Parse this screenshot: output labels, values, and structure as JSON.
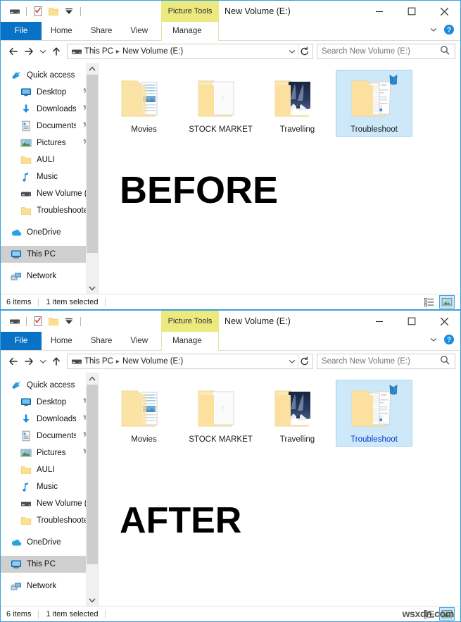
{
  "windows": [
    {
      "key": "before",
      "annotation": "BEFORE",
      "titlebar": {
        "context_tab": "Picture Tools",
        "title": "New Volume (E:)",
        "quick_access": [
          {
            "name": "drive-icon",
            "label": "Drive"
          },
          {
            "name": "properties-icon",
            "label": "Properties"
          },
          {
            "name": "new-folder-icon",
            "label": "New folder"
          },
          {
            "name": "customize-quick-access-icon",
            "label": "Customize Quick Access Toolbar"
          }
        ],
        "minimize_label": "Minimize",
        "maximize_label": "Maximize",
        "close_label": "Close"
      },
      "ribbon": {
        "tabs": [
          "File",
          "Home",
          "Share",
          "View",
          "Manage"
        ],
        "collapse_label": "Minimize the Ribbon",
        "help_label": "Help"
      },
      "address": {
        "back_label": "Back",
        "forward_label": "Forward",
        "recent_label": "Recent locations",
        "up_label": "Up",
        "crumbs": [
          "This PC",
          "New Volume (E:)"
        ],
        "dropdown_label": "Previous locations",
        "refresh_label": "Refresh",
        "search_placeholder": "Search New Volume (E:)"
      },
      "sidebar": {
        "items": [
          {
            "label": "Quick access",
            "icon": "star-icon",
            "indent": 0,
            "pinned": false,
            "selected": false
          },
          {
            "label": "Desktop",
            "icon": "desktop-icon",
            "indent": 1,
            "pinned": true,
            "selected": false
          },
          {
            "label": "Downloads",
            "icon": "download-icon",
            "indent": 1,
            "pinned": true,
            "selected": false
          },
          {
            "label": "Documents",
            "icon": "document-icon",
            "indent": 1,
            "pinned": true,
            "selected": false
          },
          {
            "label": "Pictures",
            "icon": "picture-icon",
            "indent": 1,
            "pinned": true,
            "selected": false
          },
          {
            "label": "AULI",
            "icon": "folder-icon",
            "indent": 1,
            "pinned": false,
            "selected": false
          },
          {
            "label": "Music",
            "icon": "music-icon",
            "indent": 1,
            "pinned": false,
            "selected": false
          },
          {
            "label": "New Volume (E:)",
            "icon": "drive-icon",
            "indent": 1,
            "pinned": false,
            "selected": false
          },
          {
            "label": "Troubleshooter W",
            "icon": "folder-icon",
            "indent": 1,
            "pinned": false,
            "selected": false
          },
          {
            "label": "OneDrive",
            "icon": "onedrive-icon",
            "indent": 0,
            "pinned": false,
            "selected": false,
            "gap_before": true
          },
          {
            "label": "This PC",
            "icon": "thispc-icon",
            "indent": 0,
            "pinned": false,
            "selected": true,
            "gap_before": true
          },
          {
            "label": "Network",
            "icon": "network-icon",
            "indent": 0,
            "pinned": false,
            "selected": false,
            "gap_before": true
          }
        ]
      },
      "files": [
        {
          "name": "Movies",
          "thumb": "movies-folder-icon",
          "selected": false
        },
        {
          "name": "STOCK MARKET",
          "thumb": "document-folder-icon",
          "selected": false
        },
        {
          "name": "Travelling",
          "thumb": "photo-folder-icon",
          "selected": false
        },
        {
          "name": "Troubleshoot",
          "thumb": "shortcut-folder-icon",
          "selected": true
        }
      ],
      "status": {
        "item_count": "6 items",
        "selection": "1 item selected",
        "details_view_label": "Details view",
        "large_icons_view_label": "Large icons view",
        "active_view": "large-icons"
      },
      "selected_label_blue": false
    },
    {
      "key": "after",
      "annotation": "AFTER",
      "titlebar": {
        "context_tab": "Picture Tools",
        "title": "New Volume (E:)",
        "quick_access": [
          {
            "name": "drive-icon",
            "label": "Drive"
          },
          {
            "name": "properties-icon",
            "label": "Properties"
          },
          {
            "name": "new-folder-icon",
            "label": "New folder"
          },
          {
            "name": "customize-quick-access-icon",
            "label": "Customize Quick Access Toolbar"
          }
        ],
        "minimize_label": "Minimize",
        "maximize_label": "Maximize",
        "close_label": "Close"
      },
      "ribbon": {
        "tabs": [
          "File",
          "Home",
          "Share",
          "View",
          "Manage"
        ],
        "collapse_label": "Minimize the Ribbon",
        "help_label": "Help"
      },
      "address": {
        "back_label": "Back",
        "forward_label": "Forward",
        "recent_label": "Recent locations",
        "up_label": "Up",
        "crumbs": [
          "This PC",
          "New Volume (E:)"
        ],
        "dropdown_label": "Previous locations",
        "refresh_label": "Refresh",
        "search_placeholder": "Search New Volume (E:)"
      },
      "sidebar": {
        "items": [
          {
            "label": "Quick access",
            "icon": "star-icon",
            "indent": 0,
            "pinned": false,
            "selected": false
          },
          {
            "label": "Desktop",
            "icon": "desktop-icon",
            "indent": 1,
            "pinned": true,
            "selected": false
          },
          {
            "label": "Downloads",
            "icon": "download-icon",
            "indent": 1,
            "pinned": true,
            "selected": false
          },
          {
            "label": "Documents",
            "icon": "document-icon",
            "indent": 1,
            "pinned": true,
            "selected": false
          },
          {
            "label": "Pictures",
            "icon": "picture-icon",
            "indent": 1,
            "pinned": true,
            "selected": false
          },
          {
            "label": "AULI",
            "icon": "folder-icon",
            "indent": 1,
            "pinned": false,
            "selected": false
          },
          {
            "label": "Music",
            "icon": "music-icon",
            "indent": 1,
            "pinned": false,
            "selected": false
          },
          {
            "label": "New Volume (E:)",
            "icon": "drive-icon",
            "indent": 1,
            "pinned": false,
            "selected": false
          },
          {
            "label": "Troubleshooter W",
            "icon": "folder-icon",
            "indent": 1,
            "pinned": false,
            "selected": false
          },
          {
            "label": "OneDrive",
            "icon": "onedrive-icon",
            "indent": 0,
            "pinned": false,
            "selected": false,
            "gap_before": true
          },
          {
            "label": "This PC",
            "icon": "thispc-icon",
            "indent": 0,
            "pinned": false,
            "selected": true,
            "gap_before": true
          },
          {
            "label": "Network",
            "icon": "network-icon",
            "indent": 0,
            "pinned": false,
            "selected": false,
            "gap_before": true
          }
        ]
      },
      "files": [
        {
          "name": "Movies",
          "thumb": "movies-folder-icon",
          "selected": false
        },
        {
          "name": "STOCK MARKET",
          "thumb": "document-folder-icon",
          "selected": false
        },
        {
          "name": "Travelling",
          "thumb": "photo-folder-icon",
          "selected": false
        },
        {
          "name": "Troubleshoot",
          "thumb": "shortcut-folder-icon",
          "selected": true
        }
      ],
      "status": {
        "item_count": "6 items",
        "selection": "1 item selected",
        "details_view_label": "Details view",
        "large_icons_view_label": "Large icons view",
        "active_view": "large-icons"
      },
      "selected_label_blue": true
    }
  ],
  "watermark": "wsxdn.com",
  "colors": {
    "file_tab": "#0a72c4",
    "context_tab": "#ece97f",
    "selection": "#cde8f9",
    "selection_border": "#a8d5f2",
    "window_border": "#3aa0dc",
    "nav_selected": "#cfcfcf",
    "selected_label_blue": "#0a38c8"
  }
}
